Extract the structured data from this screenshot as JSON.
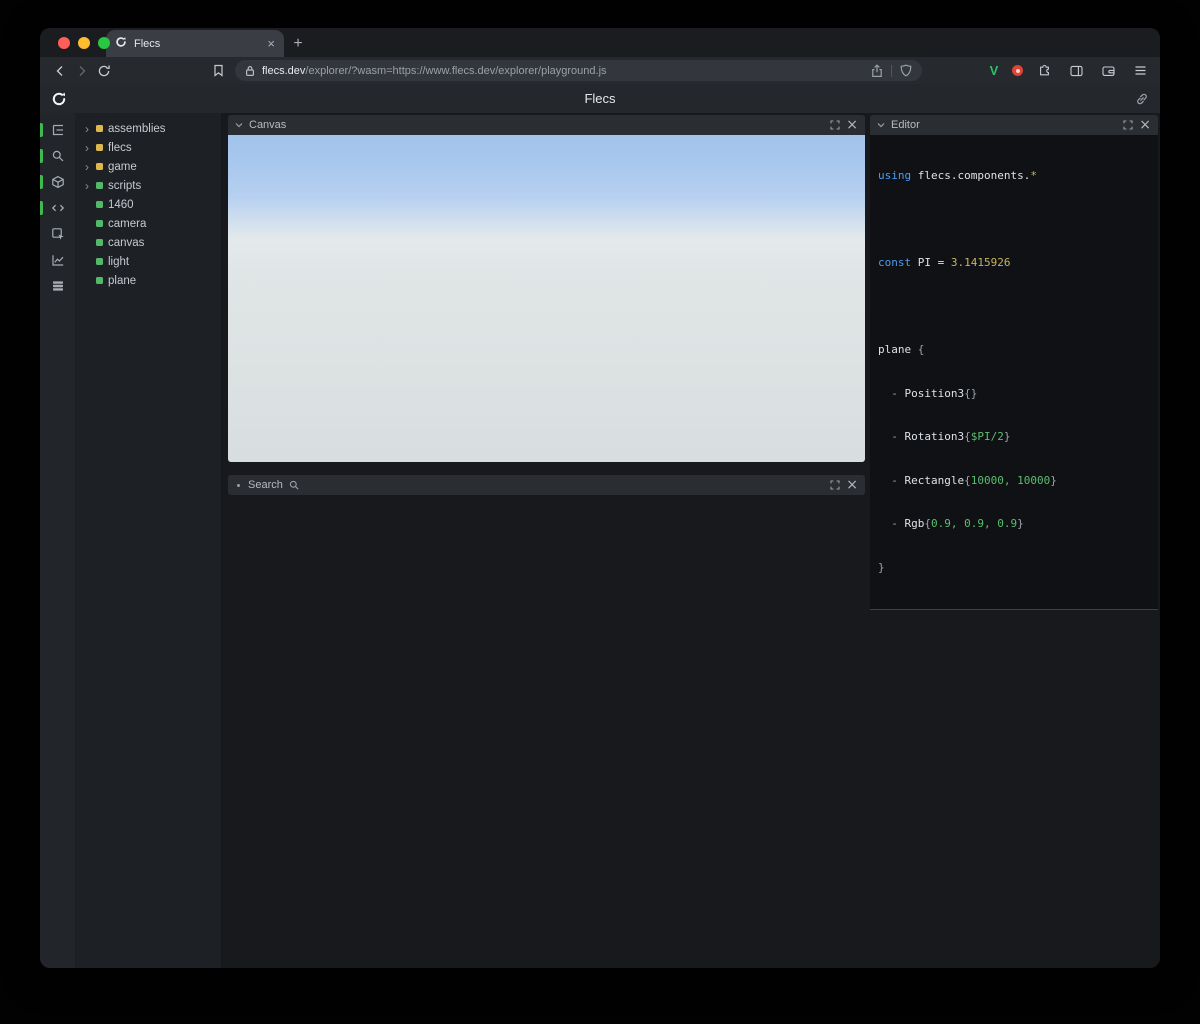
{
  "browser": {
    "tab_title": "Flecs",
    "new_tab_label": "+",
    "url_domain": "flecs.dev",
    "url_path": "/explorer/?wasm=https://www.flecs.dev/explorer/playground.js",
    "extensions": {
      "v_label": "V"
    }
  },
  "header": {
    "title": "Flecs"
  },
  "sidebar_icons": [
    "entity-tree",
    "search",
    "entities",
    "code",
    "inspector",
    "stats",
    "queries"
  ],
  "tree": {
    "items": [
      {
        "arrow": "›",
        "label": "assemblies",
        "color": "#dcb84e"
      },
      {
        "arrow": "›",
        "label": "flecs",
        "color": "#dcb84e"
      },
      {
        "arrow": "›",
        "label": "game",
        "color": "#dcb84e"
      },
      {
        "arrow": "›",
        "label": "scripts",
        "color": "#53b96a"
      },
      {
        "arrow": "",
        "label": "1460",
        "color": "#53b96a"
      },
      {
        "arrow": "",
        "label": "camera",
        "color": "#53b96a"
      },
      {
        "arrow": "",
        "label": "canvas",
        "color": "#53b96a"
      },
      {
        "arrow": "",
        "label": "light",
        "color": "#53b96a"
      },
      {
        "arrow": "",
        "label": "plane",
        "color": "#53b96a"
      }
    ]
  },
  "panels": {
    "canvas": {
      "title": "Canvas"
    },
    "search": {
      "title": "Search"
    },
    "editor": {
      "title": "Editor"
    }
  },
  "editor_code": {
    "lines": [
      {
        "s": [
          "using ",
          "flecs.components.",
          "*"
        ]
      },
      {
        "s": []
      },
      {
        "s": [
          "const ",
          "PI = ",
          "3.1415926"
        ]
      },
      {
        "s": []
      },
      {
        "s": [
          "plane ",
          "{"
        ]
      },
      {
        "s": [
          "  - ",
          "Position3",
          "{}"
        ]
      },
      {
        "s": [
          "  - ",
          "Rotation3",
          "{",
          "$PI/2",
          "}"
        ]
      },
      {
        "s": [
          "  - ",
          "Rectangle",
          "{",
          "10000, 10000",
          "}"
        ]
      },
      {
        "s": [
          "  - ",
          "Rgb",
          "{",
          "0.9, 0.9, 0.9",
          "}"
        ]
      },
      {
        "s": [
          "}"
        ]
      }
    ]
  },
  "colors": {
    "accent_green": "#3fb950",
    "module_yellow": "#dcb84e",
    "entity_green": "#53b96a",
    "sky_top": "#a5c6ed",
    "sky_horizon": "#e6ebec",
    "ground": "#dde2e3"
  }
}
